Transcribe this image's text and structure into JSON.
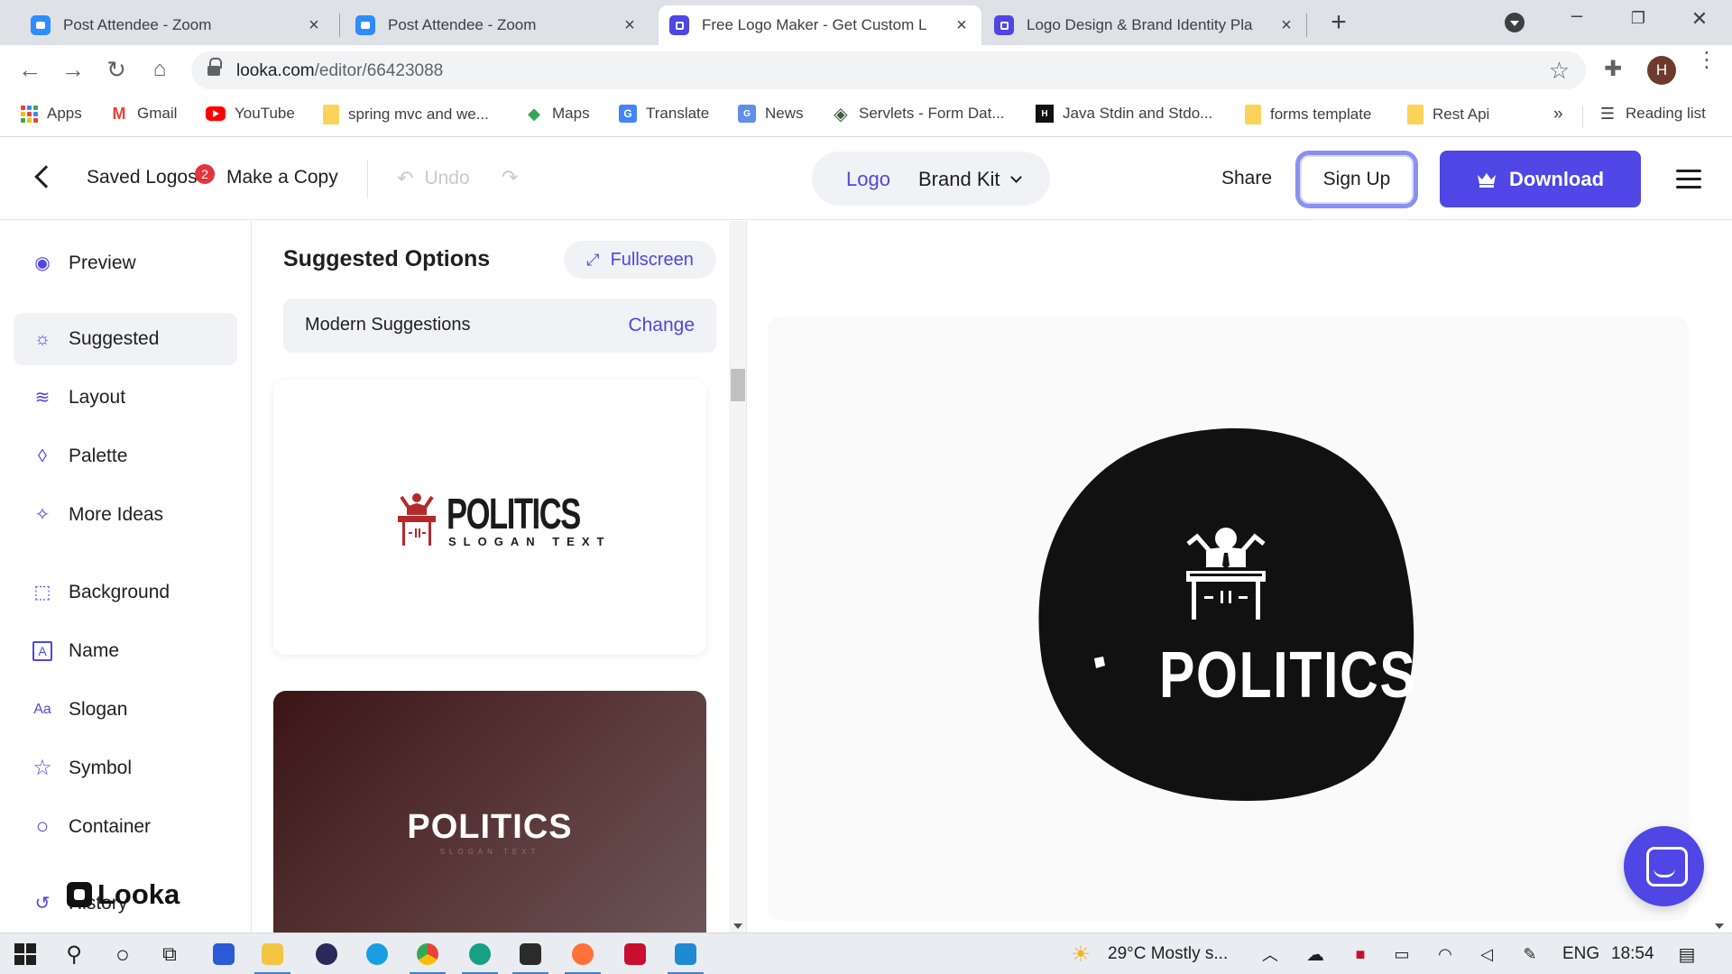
{
  "browser": {
    "tabs": [
      {
        "title": "Post Attendee - Zoom",
        "favicon": "zoom-icon",
        "active": false
      },
      {
        "title": "Post Attendee - Zoom",
        "favicon": "zoom-icon",
        "active": false
      },
      {
        "title": "Free Logo Maker - Get Custom L",
        "favicon": "looka-icon",
        "active": true
      },
      {
        "title": "Logo Design & Brand Identity Pla",
        "favicon": "looka-icon",
        "active": false
      }
    ],
    "url_host": "looka.com",
    "url_path": "/editor/66423088",
    "profile_initial": "H",
    "bookmarks": [
      {
        "label": "Apps",
        "icon": "apps-grid-icon"
      },
      {
        "label": "Gmail",
        "icon": "gmail-icon"
      },
      {
        "label": "YouTube",
        "icon": "youtube-icon"
      },
      {
        "label": "spring mvc and we...",
        "icon": "folder-icon"
      },
      {
        "label": "Maps",
        "icon": "maps-icon"
      },
      {
        "label": "Translate",
        "icon": "translate-icon"
      },
      {
        "label": "News",
        "icon": "news-icon"
      },
      {
        "label": "Servlets - Form Dat...",
        "icon": "servlets-icon"
      },
      {
        "label": "Java Stdin and Stdo...",
        "icon": "hackerrank-icon"
      },
      {
        "label": "forms template",
        "icon": "folder-icon"
      },
      {
        "label": "Rest Api",
        "icon": "folder-icon"
      }
    ],
    "bookmarks_more": "»",
    "reading_list": "Reading list"
  },
  "header": {
    "saved_logos": "Saved Logos",
    "saved_count": "2",
    "make_copy": "Make a Copy",
    "undo": "Undo",
    "tab_logo": "Logo",
    "tab_brand_kit": "Brand Kit",
    "share": "Share",
    "sign_up": "Sign Up",
    "download": "Download"
  },
  "sidebar": {
    "items": [
      {
        "label": "Preview",
        "icon": "eye-icon",
        "glyph": "◉"
      },
      {
        "label": "Suggested",
        "icon": "lightbulb-icon",
        "glyph": "☼"
      },
      {
        "label": "Layout",
        "icon": "layers-icon",
        "glyph": "≋"
      },
      {
        "label": "Palette",
        "icon": "droplet-icon",
        "glyph": "◊"
      },
      {
        "label": "More Ideas",
        "icon": "magic-wand-icon",
        "glyph": "✧"
      },
      {
        "label": "Background",
        "icon": "background-icon",
        "glyph": "⬚"
      },
      {
        "label": "Name",
        "icon": "name-icon",
        "glyph": "A"
      },
      {
        "label": "Slogan",
        "icon": "slogan-icon",
        "glyph": "Aa"
      },
      {
        "label": "Symbol",
        "icon": "star-icon",
        "glyph": "☆"
      },
      {
        "label": "Container",
        "icon": "circle-icon",
        "glyph": "○"
      },
      {
        "label": "History",
        "icon": "history-icon",
        "glyph": "↺"
      }
    ],
    "brand": "Looka"
  },
  "panel": {
    "title": "Suggested Options",
    "fullscreen": "Fullscreen",
    "suggestion_type": "Modern Suggestions",
    "change": "Change",
    "cards": [
      {
        "name": "POLITICS",
        "slogan": "SLOGAN TEXT"
      },
      {
        "name": "POLITICS",
        "slogan": "SLOGAN TEXT"
      }
    ]
  },
  "canvas": {
    "logo_name": "POLITICS"
  },
  "taskbar": {
    "weather": "29°C  Mostly s...",
    "language": "ENG",
    "time": "18:54"
  },
  "colors": {
    "accent": "#4f46e5",
    "badge": "#e5343d",
    "card1_symbol": "#b42a2a",
    "card2_bg": "#4a2a2b",
    "blob": "#111111"
  }
}
